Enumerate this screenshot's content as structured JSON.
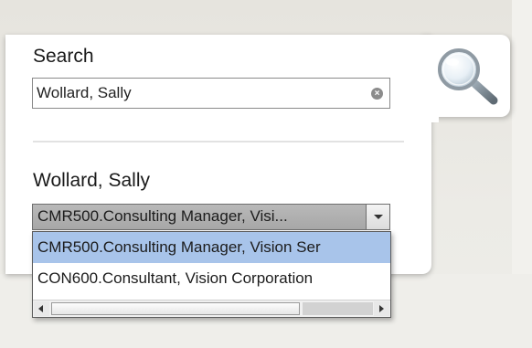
{
  "search": {
    "label": "Search",
    "value": "Wollard, Sally",
    "clear_icon": "clear-circle-icon",
    "search_icon": "magnifier-icon"
  },
  "result": {
    "name": "Wollard, Sally",
    "selected_value": "CMR500.Consulting Manager, Visi...",
    "options": [
      {
        "label": "CMR500.Consulting Manager, Vision Ser",
        "selected": true
      },
      {
        "label": "CON600.Consultant, Vision Corporation",
        "selected": false
      }
    ]
  },
  "colors": {
    "selected_option": "#a8c4ea",
    "panel": "#ffffff",
    "background": "#e9e7e1"
  }
}
